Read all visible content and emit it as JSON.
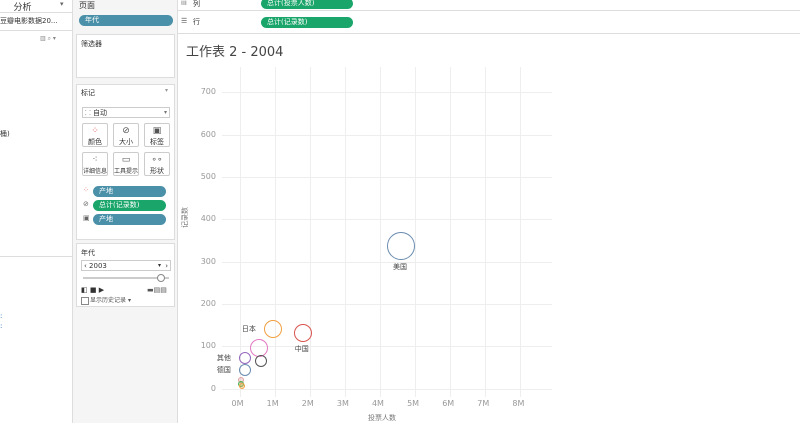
{
  "left_panel": {
    "tab_analysis": "分析",
    "datasource": "豆瓣电影数据20...",
    "fragment_1": "桶)"
  },
  "pages": {
    "title": "页面",
    "pill": "年代"
  },
  "filters": {
    "title": "筛选器"
  },
  "marks": {
    "title": "标记",
    "type": "自动",
    "buttons": [
      {
        "label": "颜色"
      },
      {
        "label": "大小"
      },
      {
        "label": "标签"
      },
      {
        "label": "详细信息"
      },
      {
        "label": "工具提示"
      },
      {
        "label": "形状"
      }
    ],
    "pills": [
      {
        "label": "产地",
        "icon": "color-dots-icon"
      },
      {
        "label": "总计(记录数)",
        "icon": "size-icon"
      },
      {
        "label": "产地",
        "icon": "label-icon"
      }
    ]
  },
  "year_card": {
    "title": "年代",
    "selected": "2003",
    "show_history": "显示历史记录"
  },
  "shelves": {
    "columns_label": "列",
    "columns_pill": "总计(投票人数)",
    "rows_label": "行",
    "rows_pill": "总计(记录数)"
  },
  "sheet_title": "工作表 2 - 2004",
  "chart_data": {
    "type": "scatter",
    "title": "",
    "xlabel": "投票人数",
    "ylabel": "记录数",
    "xlim": [
      -0.5,
      8.9
    ],
    "ylim": [
      -20,
      760
    ],
    "x_unit": "M",
    "x_ticks": [
      "0M",
      "1M",
      "2M",
      "3M",
      "4M",
      "5M",
      "6M",
      "7M",
      "8M"
    ],
    "y_ticks": [
      "0",
      "100",
      "200",
      "300",
      "400",
      "500",
      "600",
      "700"
    ],
    "points": [
      {
        "label": "美国",
        "x": 4.6,
        "y": 336,
        "color": "#6a8caf",
        "size": "large"
      },
      {
        "label": "日本",
        "x": 0.95,
        "y": 141,
        "color": "#f0a040",
        "size": "medium"
      },
      {
        "label": "中国",
        "x": 1.8,
        "y": 131,
        "color": "#d9534f",
        "size": "medium"
      },
      {
        "label": "其他",
        "x": 0.15,
        "y": 73,
        "color": "#9467bd",
        "size": "small"
      },
      {
        "label": "",
        "x": 0.55,
        "y": 95,
        "color": "#e377c2",
        "size": "medium"
      },
      {
        "label": "",
        "x": 0.6,
        "y": 64,
        "color": "#555",
        "size": "small"
      },
      {
        "label": "德国",
        "x": 0.15,
        "y": 43,
        "color": "#6a8caf",
        "size": "small"
      },
      {
        "label": "",
        "x": 0.05,
        "y": 20,
        "color": "#e0a0a0",
        "size": "tiny"
      },
      {
        "label": "",
        "x": 0.03,
        "y": 10,
        "color": "#4caf50",
        "size": "tiny"
      },
      {
        "label": "",
        "x": 0.08,
        "y": 5,
        "color": "#f0a040",
        "size": "tiny"
      }
    ]
  }
}
